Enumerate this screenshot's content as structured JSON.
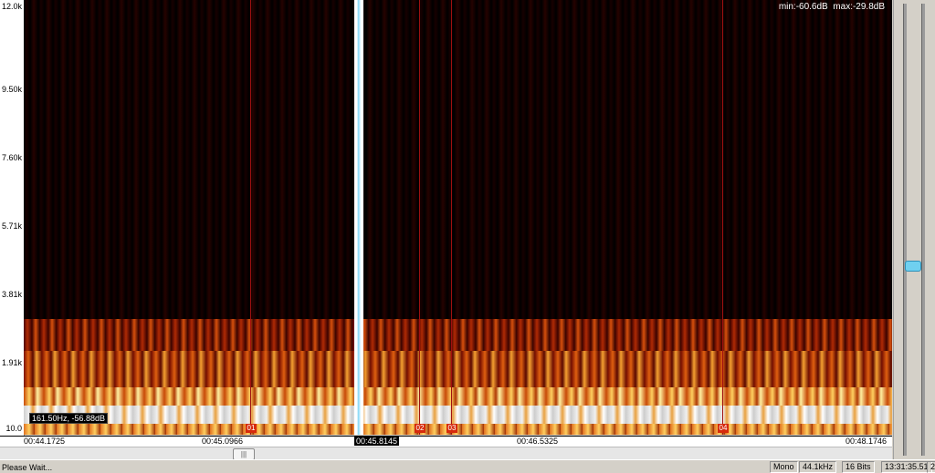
{
  "y_axis": {
    "labels": [
      "12.0k",
      "9.50k",
      "7.60k",
      "5.71k",
      "3.81k",
      "1.91k",
      "10.0"
    ]
  },
  "spectrogram": {
    "min_label": "min:-60.6dB",
    "max_label": "max:-29.8dB",
    "cursor_readout": "161.50Hz, -56.88dB",
    "markers": [
      {
        "label": "01"
      },
      {
        "label": "02"
      },
      {
        "label": "03"
      },
      {
        "label": "04"
      }
    ]
  },
  "timeline": {
    "labels": [
      "00:44.1725",
      "00:45.0966",
      "00:45.8145",
      "00:46.5325",
      "00:48.1746"
    ]
  },
  "scrollbar": {
    "thumb_glyph": "|||"
  },
  "status": {
    "message": "Please Wait...",
    "channels": "Mono",
    "sample_rate": "44.1kHz",
    "bit_depth": "16 Bits",
    "time": "13:31:35.51",
    "extra": "2"
  },
  "colors": {
    "low_energy": "#3a0000",
    "mid_energy": "#c83a08",
    "high_energy": "#ffd060",
    "peak": "#f0f0f0",
    "marker": "#d62a0c",
    "playhead": "#7fd6f5"
  }
}
